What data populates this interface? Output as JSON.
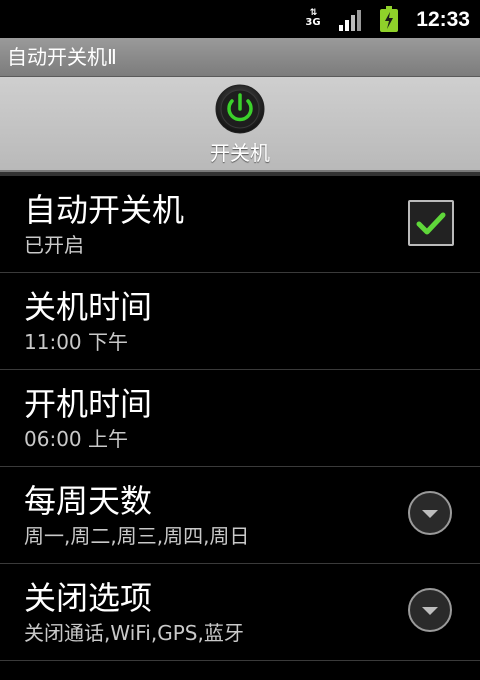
{
  "status_bar": {
    "network_label": "3G",
    "network_arrows": "⇅",
    "time": "12:33",
    "icons": [
      "network-3g-icon",
      "signal-icon",
      "battery-charging-icon"
    ]
  },
  "app": {
    "title": "自动开关机Ⅱ"
  },
  "header": {
    "label": "开关机",
    "icon": "power-icon",
    "accent": "#3bd12b"
  },
  "settings": [
    {
      "title": "自动开关机",
      "summary": "已开启",
      "control": "checkbox",
      "checked": true
    },
    {
      "title": "关机时间",
      "summary": "11:00  下午"
    },
    {
      "title": "开机时间",
      "summary": "06:00  上午"
    },
    {
      "title": "每周天数",
      "summary": "周一,周二,周三,周四,周日",
      "control": "dropdown"
    },
    {
      "title": "关闭选项",
      "summary": "关闭通话,WiFi,GPS,蓝牙",
      "control": "dropdown"
    }
  ],
  "colors": {
    "checkmark": "#5fd73a",
    "battery": "#8fd12a"
  }
}
